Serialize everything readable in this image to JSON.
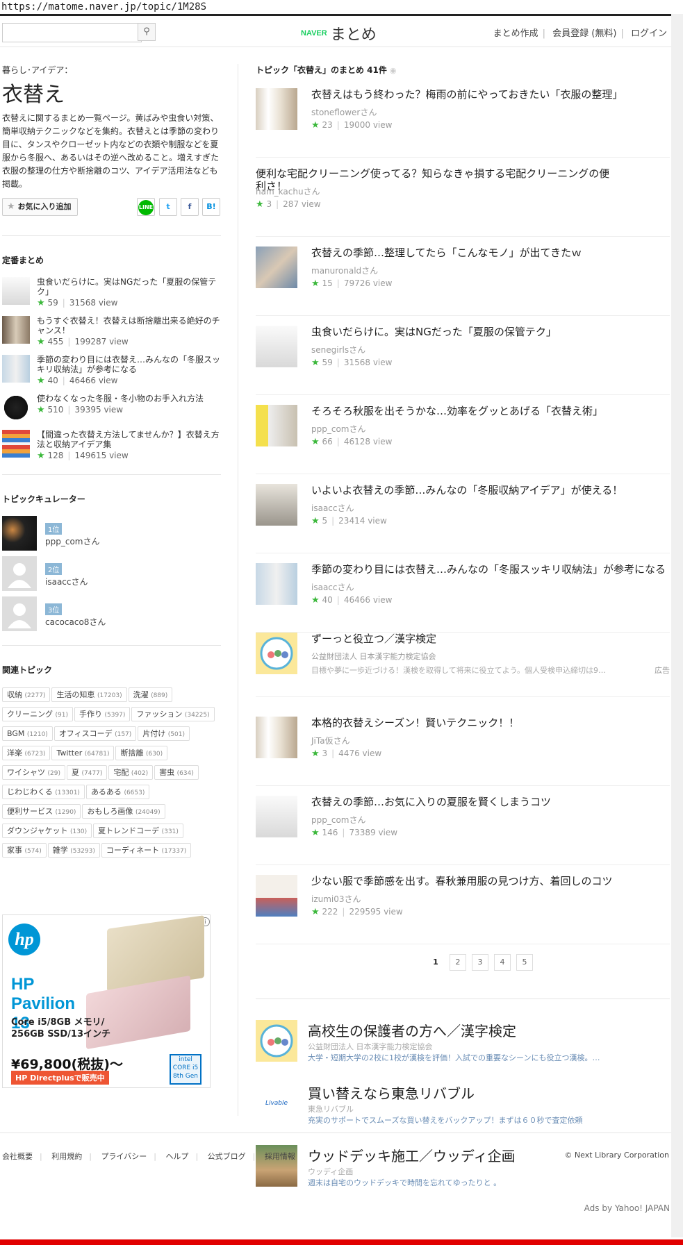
{
  "browser": {
    "url": "https://matome.naver.jp/topic/1M28S"
  },
  "header": {
    "search_placeholder": "",
    "logo_naver": "NAVER",
    "logo_matome": "まとめ",
    "links": [
      "まとめ作成",
      "会員登録 (無料)",
      "ログイン"
    ]
  },
  "topic": {
    "category": "暮らし･アイデア：",
    "title": "衣替え",
    "description": "衣替えに関するまとめ一覧ページ。黄ばみや虫食い対策、簡単収納テクニックなどを集約。衣替えとは季節の変わり目に、タンスやクローゼット内などの衣類や制服などを夏服から冬服へ、あるいはその逆へ改めること。増えすぎた衣服の整理の仕方や断捨離のコツ、アイデア活用法なども掲載。",
    "fav_label": "お気に入り追加",
    "share": {
      "line": "LINE",
      "twitter": "t",
      "facebook": "f",
      "hatena": "B!"
    }
  },
  "standard": {
    "title": "定番まとめ",
    "items": [
      {
        "title": "虫食いだらけに。実はNGだった「夏服の保管テク」",
        "stars": "59",
        "views": "31568",
        "view_label": "view"
      },
      {
        "title": "もうすぐ衣替え！衣替えは断捨離出来る絶好のチャンス！",
        "stars": "455",
        "views": "199287",
        "view_label": "view"
      },
      {
        "title": "季節の変わり目には衣替え…みんなの「冬服スッキリ収納法」が参考になる",
        "stars": "40",
        "views": "46466",
        "view_label": "view"
      },
      {
        "title": "使わなくなった冬服・冬小物のお手入れ方法",
        "stars": "510",
        "views": "39395",
        "view_label": "view"
      },
      {
        "title": "【間違った衣替え方法してませんか？】衣替え方法と収納アイデア集",
        "stars": "128",
        "views": "149615",
        "view_label": "view"
      }
    ]
  },
  "curators": {
    "title": "トピックキュレーター",
    "items": [
      {
        "rank": "1位",
        "name": "ppp_comさん"
      },
      {
        "rank": "2位",
        "name": "isaaccさん"
      },
      {
        "rank": "3位",
        "name": "cacocaco8さん"
      }
    ]
  },
  "related": {
    "title": "関連トピック",
    "tags": [
      {
        "name": "収納",
        "count": "(2277)"
      },
      {
        "name": "生活の知恵",
        "count": "(17203)"
      },
      {
        "name": "洗濯",
        "count": "(889)"
      },
      {
        "name": "クリーニング",
        "count": "(91)"
      },
      {
        "name": "手作り",
        "count": "(5397)"
      },
      {
        "name": "ファッション",
        "count": "(34225)"
      },
      {
        "name": "BGM",
        "count": "(1210)"
      },
      {
        "name": "オフィスコーデ",
        "count": "(157)"
      },
      {
        "name": "片付け",
        "count": "(501)"
      },
      {
        "name": "洋楽",
        "count": "(6723)"
      },
      {
        "name": "Twitter",
        "count": "(64781)"
      },
      {
        "name": "断捨離",
        "count": "(630)"
      },
      {
        "name": "ワイシャツ",
        "count": "(29)"
      },
      {
        "name": "夏",
        "count": "(7477)"
      },
      {
        "name": "宅配",
        "count": "(402)"
      },
      {
        "name": "害虫",
        "count": "(634)"
      },
      {
        "name": "じわじわくる",
        "count": "(13301)"
      },
      {
        "name": "あるある",
        "count": "(6653)"
      },
      {
        "name": "便利サービス",
        "count": "(1290)"
      },
      {
        "name": "おもしろ画像",
        "count": "(24049)"
      },
      {
        "name": "ダウンジャケット",
        "count": "(130)"
      },
      {
        "name": "夏トレンドコーデ",
        "count": "(331)"
      },
      {
        "name": "家事",
        "count": "(574)"
      },
      {
        "name": "雑学",
        "count": "(53293)"
      },
      {
        "name": "コーディネート",
        "count": "(17337)"
      }
    ]
  },
  "side_ad": {
    "brand": "hp",
    "product": "HP Pavilion 13",
    "spec_line1": "Core i5/8GB メモリ/",
    "spec_line2": "256GB SSD/13インチ",
    "price": "¥69,800(税抜)〜",
    "cta": "HP Directplusで販売中",
    "intel": "intel CORE i5 8th Gen"
  },
  "main": {
    "list_title": "トピック「衣替え」のまとめ  41件",
    "items": [
      {
        "title": "衣替えはもう終わった？梅雨の前にやっておきたい「衣服の整理」",
        "author": "stoneflowerさん",
        "stars": "23",
        "views": "19000",
        "view_label": "view"
      },
      {
        "title": "便利な宅配クリーニング使ってる？知らなきゃ損する宅配クリーニングの便利さ！",
        "author": "ham_kachuさん",
        "stars": "3",
        "views": "287",
        "view_label": "view"
      },
      {
        "title": "衣替えの季節…整理してたら「こんなモノ」が出てきたｗ",
        "author": "manuronaldさん",
        "stars": "15",
        "views": "79726",
        "view_label": "view"
      },
      {
        "title": "虫食いだらけに。実はNGだった「夏服の保管テク」",
        "author": "senegirlsさん",
        "stars": "59",
        "views": "31568",
        "view_label": "view"
      },
      {
        "title": "そろそろ秋服を出そうかな…効率をグッとあげる「衣替え術」",
        "author": "ppp_comさん",
        "stars": "66",
        "views": "46128",
        "view_label": "view"
      },
      {
        "title": "いよいよ衣替えの季節…みんなの「冬服収納アイデア」が使える！",
        "author": "isaaccさん",
        "stars": "5",
        "views": "23414",
        "view_label": "view"
      },
      {
        "title": "季節の変わり目には衣替え…みんなの「冬服スッキリ収納法」が参考になる",
        "author": "isaaccさん",
        "stars": "40",
        "views": "46466",
        "view_label": "view"
      }
    ],
    "inline_ad": {
      "title": "ずーっと役立つ／漢字検定",
      "sponsor": "公益財団法人 日本漢字能力検定協会",
      "text": "目標や夢に一歩近づける！漢検を取得して将来に役立てよう。個人受検申込締切は9…",
      "tag": "広告"
    },
    "items2": [
      {
        "title": "本格的衣替えシーズン！賢いテクニック！！",
        "author": "JiTa仮さん",
        "stars": "3",
        "views": "4476",
        "view_label": "view"
      },
      {
        "title": "衣替えの季節…お気に入りの夏服を賢くしまうコツ",
        "author": "ppp_comさん",
        "stars": "146",
        "views": "73389",
        "view_label": "view"
      },
      {
        "title": "少ない服で季節感を出す。春秋兼用服の見つけ方、着回しのコツ",
        "author": "izumi03さん",
        "stars": "222",
        "views": "229595",
        "view_label": "view"
      }
    ],
    "pages": [
      "1",
      "2",
      "3",
      "4",
      "5"
    ]
  },
  "promo_ads": [
    {
      "title": "高校生の保護者の方へ／漢字検定",
      "sponsor": "公益財団法人 日本漢字能力検定協会",
      "desc": "大学・短期大学の2校に1校が漢検を評価！入試での重要なシーンにも役立つ漢検。…"
    },
    {
      "title": "買い替えなら東急リバブル",
      "sponsor": "東急リバブル",
      "desc": "充実のサポートでスムーズな買い替えをバックアップ！まずは６０秒で査定依頼"
    },
    {
      "title": "ウッドデッキ施工／ウッディ企画",
      "sponsor": "ウッディ企画",
      "desc": "週末は自宅のウッドデッキで時間を忘れてゆったりと 。"
    }
  ],
  "ads_by": "Ads by Yahoo! JAPAN",
  "footer": {
    "links": [
      "会社概要",
      "利用規約",
      "プライバシー",
      "ヘルプ",
      "公式ブログ",
      "採用情報"
    ],
    "copyright": "© Next Library Corporation"
  }
}
